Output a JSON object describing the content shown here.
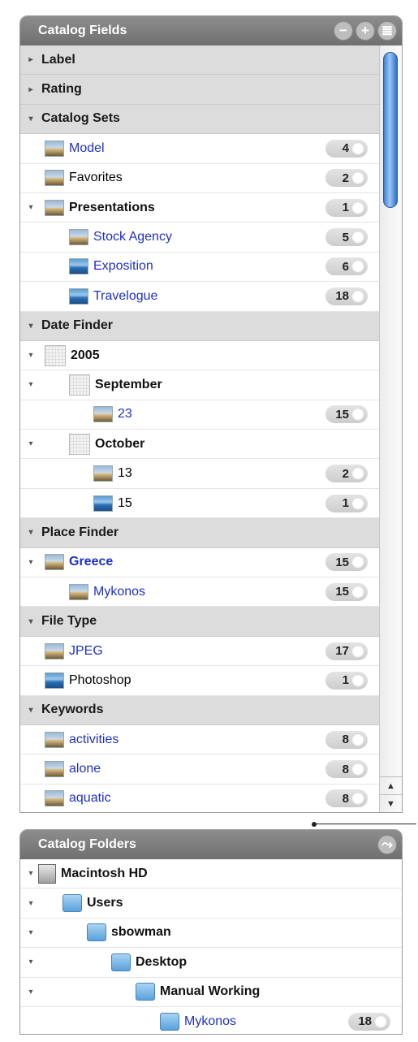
{
  "catalog_fields": {
    "title": "Catalog Fields",
    "buttons": [
      "−",
      "+",
      "≣"
    ],
    "rows": [
      {
        "label": "Label",
        "type": "section",
        "tri": "▸"
      },
      {
        "label": "Rating",
        "type": "section",
        "tri": "▸"
      },
      {
        "label": "Catalog Sets",
        "type": "section",
        "tri": "▾"
      },
      {
        "label": "Model",
        "style": "blue",
        "thumb": "photo",
        "count": "4",
        "indent": 0
      },
      {
        "label": "Favorites",
        "style": "plain",
        "thumb": "photo",
        "count": "2",
        "indent": 0
      },
      {
        "label": "Presentations",
        "style": "bold",
        "thumb": "photo",
        "count": "1",
        "indent": 0,
        "tri": "▾"
      },
      {
        "label": "Stock Agency",
        "style": "blue",
        "thumb": "photo",
        "count": "5",
        "indent": 1
      },
      {
        "label": "Exposition",
        "style": "blue",
        "thumb": "sea",
        "count": "6",
        "indent": 1
      },
      {
        "label": "Travelogue",
        "style": "blue",
        "thumb": "sea",
        "count": "18",
        "indent": 1
      },
      {
        "label": "Date Finder",
        "type": "section",
        "tri": "▾"
      },
      {
        "label": "2005",
        "style": "bold",
        "thumb": "grid",
        "indent": 0,
        "tri": "▾"
      },
      {
        "label": "September",
        "style": "bold",
        "thumb": "grid",
        "indent": 1,
        "tri": "▾"
      },
      {
        "label": "23",
        "style": "blue",
        "thumb": "photo",
        "count": "15",
        "indent": 2
      },
      {
        "label": "October",
        "style": "bold",
        "thumb": "grid",
        "indent": 1,
        "tri": "▾"
      },
      {
        "label": "13",
        "style": "plain",
        "thumb": "photo",
        "count": "2",
        "indent": 2
      },
      {
        "label": "15",
        "style": "plain",
        "thumb": "sea",
        "count": "1",
        "indent": 2
      },
      {
        "label": "Place Finder",
        "type": "section",
        "tri": "▾"
      },
      {
        "label": "Greece",
        "style": "blue-bold",
        "thumb": "photo",
        "count": "15",
        "indent": 0,
        "tri": "▾"
      },
      {
        "label": "Mykonos",
        "style": "blue",
        "thumb": "photo",
        "count": "15",
        "indent": 1
      },
      {
        "label": "File Type",
        "type": "section",
        "tri": "▾"
      },
      {
        "label": "JPEG",
        "style": "blue",
        "thumb": "photo",
        "count": "17",
        "indent": 0
      },
      {
        "label": "Photoshop",
        "style": "plain",
        "thumb": "sea",
        "count": "1",
        "indent": 0
      },
      {
        "label": "Keywords",
        "type": "section",
        "tri": "▾"
      },
      {
        "label": "activities",
        "style": "blue",
        "thumb": "photo",
        "count": "8",
        "indent": 0
      },
      {
        "label": "alone",
        "style": "blue",
        "thumb": "photo",
        "count": "8",
        "indent": 0
      },
      {
        "label": "aquatic",
        "style": "blue",
        "thumb": "photo",
        "count": "8",
        "indent": 0
      }
    ]
  },
  "catalog_folders": {
    "title": "Catalog Folders",
    "rows": [
      {
        "label": "Macintosh HD",
        "style": "bold",
        "thumb": "disk",
        "indent": 0,
        "tri": "▾"
      },
      {
        "label": "Users",
        "style": "bold",
        "thumb": "folder",
        "indent": 1,
        "tri": "▾"
      },
      {
        "label": "sbowman",
        "style": "bold",
        "thumb": "folder",
        "indent": 2,
        "tri": "▾"
      },
      {
        "label": "Desktop",
        "style": "bold",
        "thumb": "folder",
        "indent": 3,
        "tri": "▾"
      },
      {
        "label": "Manual Working",
        "style": "bold",
        "thumb": "folder",
        "indent": 4,
        "tri": "▾"
      },
      {
        "label": "Mykonos",
        "style": "blue",
        "thumb": "folder",
        "count": "18",
        "indent": 5
      }
    ]
  },
  "icons": {
    "collapsed": "disclosure-right-icon",
    "expanded": "disclosure-down-icon",
    "sync": "sync-icon"
  },
  "colors": {
    "link": "#1f2fc8",
    "header": "#7c7c7c",
    "section_bg": "#dcdcdc"
  }
}
